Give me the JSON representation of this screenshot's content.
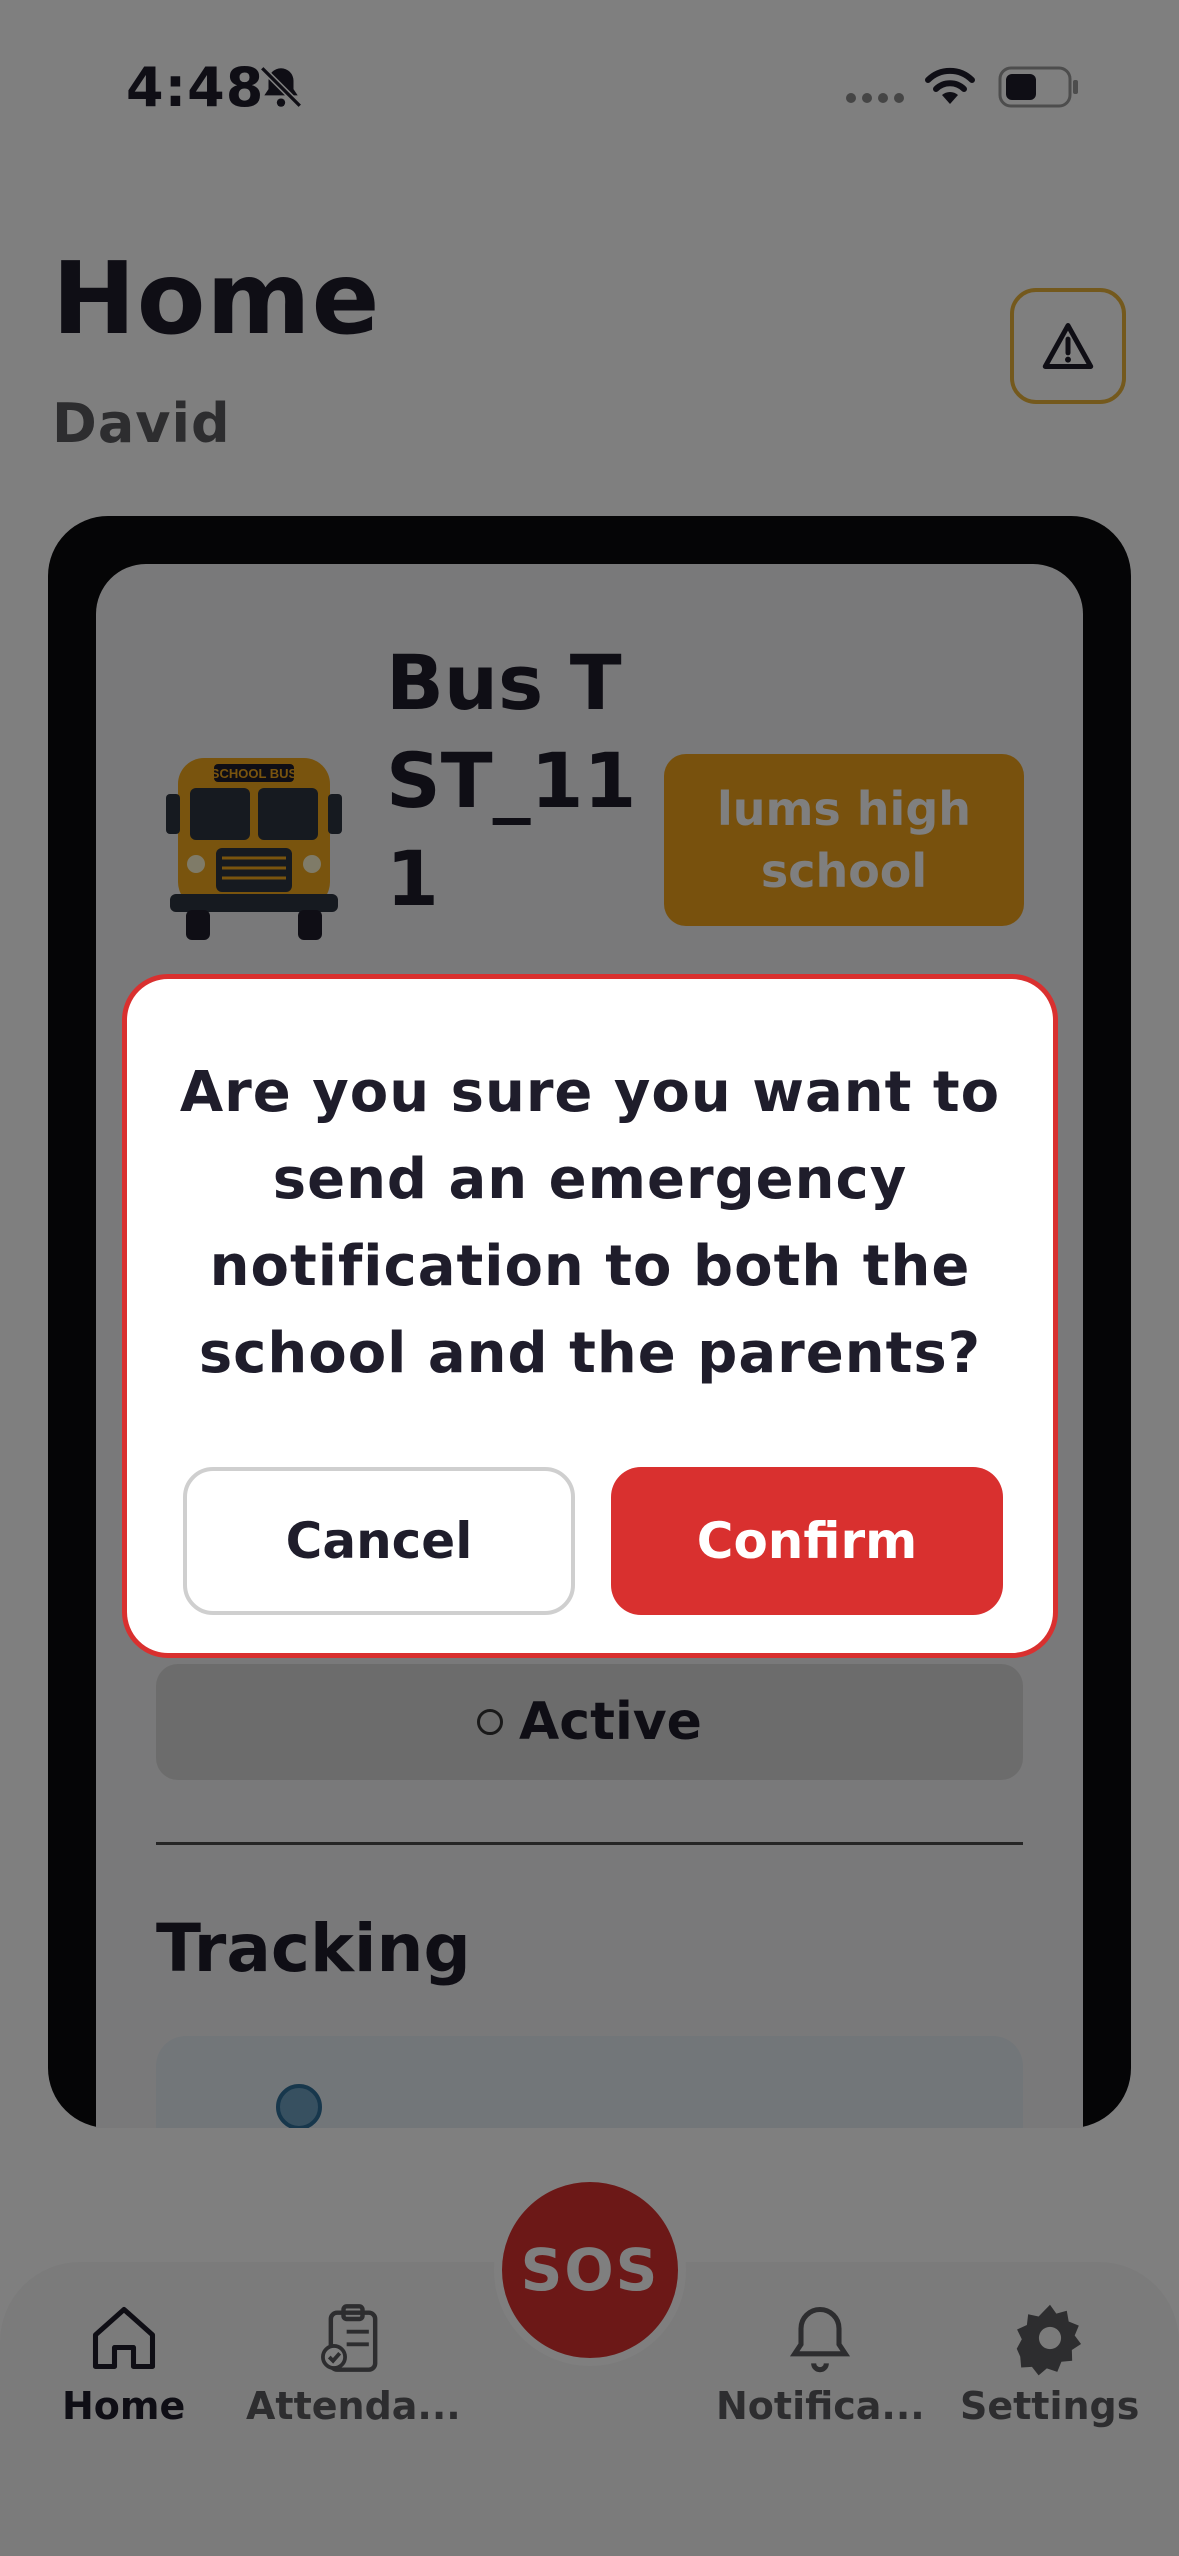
{
  "status_bar": {
    "time": "4:48"
  },
  "header": {
    "title": "Home",
    "subtitle": "David"
  },
  "bus_card": {
    "bus_name": "Bus TST_111",
    "school": "lums high school",
    "status_label": "Active",
    "tracking_heading": "Tracking"
  },
  "tabbar": {
    "home": "Home",
    "attendance": "Attenda...",
    "sos": "SOS",
    "notifications": "Notifica...",
    "settings": "Settings"
  },
  "modal": {
    "message": "Are you sure you want to send an emergency notification to both the school and the parents?",
    "cancel_label": "Cancel",
    "confirm_label": "Confirm"
  },
  "colors": {
    "accent_red": "#d9302f",
    "badge_orange": "#f0a21a",
    "alert_border": "#e8b33a"
  }
}
